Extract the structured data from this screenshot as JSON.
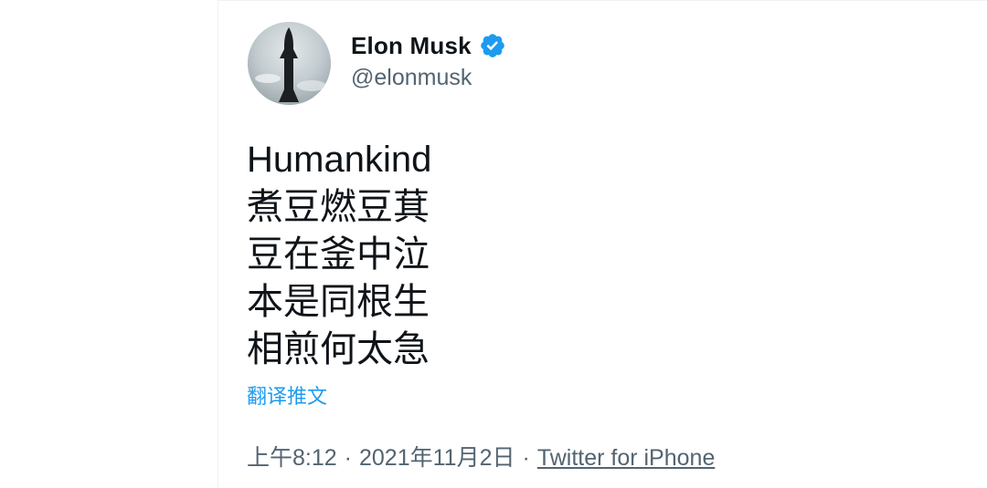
{
  "tweet": {
    "author": {
      "name": "Elon Musk",
      "handle": "@elonmusk",
      "verified_icon": "verified-badge-icon",
      "avatar_icon": "starship-rocket"
    },
    "text_lines": [
      "Humankind",
      "煮豆燃豆萁",
      "豆在釜中泣",
      "本是同根生",
      "相煎何太急"
    ],
    "translate_link": "翻译推文",
    "time": "上午8:12",
    "separator": "·",
    "date": "2021年11月2日",
    "source": "Twitter for iPhone"
  },
  "colors": {
    "text": "#0f1419",
    "secondary": "#536471",
    "link": "#1d9bf0",
    "badge": "#1d9bf0"
  }
}
